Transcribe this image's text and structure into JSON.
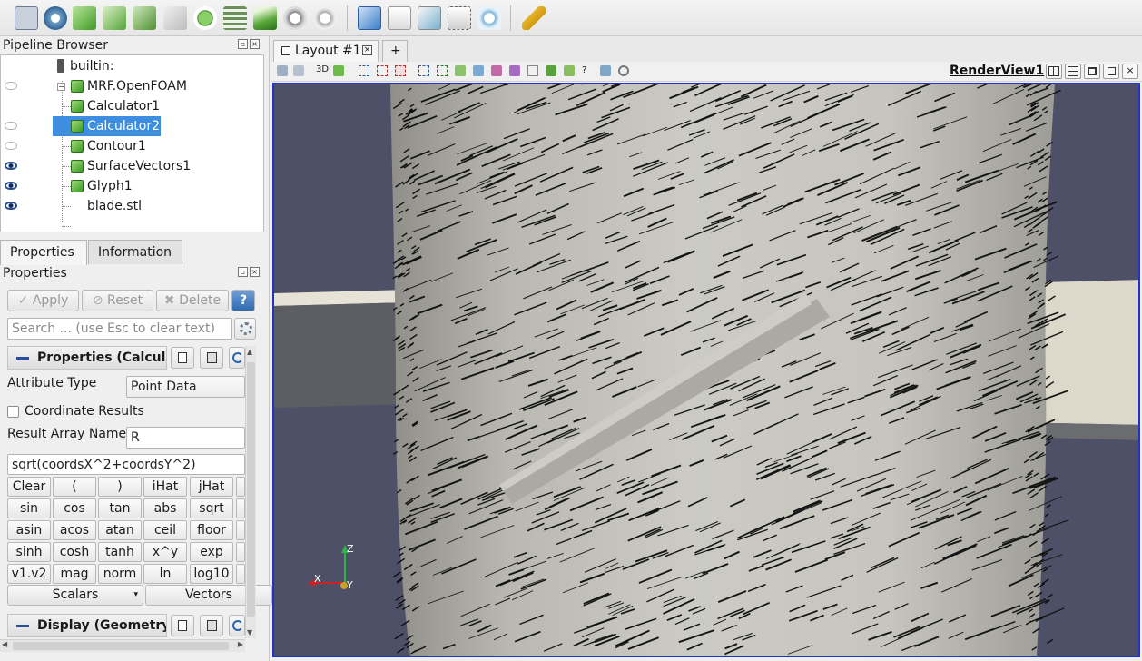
{
  "toolbar": {
    "icons": [
      "calculator-icon",
      "contour-icon",
      "clip-icon",
      "slice-icon",
      "threshold-icon",
      "extract-subset-icon",
      "glyph-icon",
      "stream-tracer-icon",
      "warp-by-vector-icon",
      "group-datasets-icon",
      "extract-level-icon",
      "select-cells-icon",
      "histogram-icon",
      "plot-over-line-icon",
      "probe-icon",
      "axes-grid-icon",
      "ruler-icon"
    ]
  },
  "pipeline_browser": {
    "title": "Pipeline Browser",
    "items": [
      {
        "label": "builtin:",
        "visible": null,
        "selected": false
      },
      {
        "label": "MRF.OpenFOAM",
        "visible": false,
        "selected": false
      },
      {
        "label": "Calculator1",
        "visible": false,
        "selected": false
      },
      {
        "label": "Calculator2",
        "visible": false,
        "selected": true
      },
      {
        "label": "Contour1",
        "visible": false,
        "selected": false
      },
      {
        "label": "SurfaceVectors1",
        "visible": true,
        "selected": false
      },
      {
        "label": "Glyph1",
        "visible": true,
        "selected": false
      },
      {
        "label": "blade.stl",
        "visible": true,
        "selected": false
      }
    ]
  },
  "tabs": {
    "properties": "Properties",
    "information": "Information"
  },
  "properties": {
    "title": "Properties",
    "apply": "Apply",
    "reset": "Reset",
    "delete": "Delete",
    "help": "?",
    "search_placeholder": "Search ... (use Esc to clear text)",
    "section_properties": "Properties (Calcula",
    "attribute_type_label": "Attribute Type",
    "attribute_type_value": "Point Data",
    "coordinate_results_label": "Coordinate Results",
    "result_array_label": "Result Array Name",
    "result_array_value": "R",
    "expression": "sqrt(coordsX^2+coordsY^2)",
    "keypad": [
      [
        "Clear",
        "(",
        ")",
        "iHat",
        "jHat"
      ],
      [
        "sin",
        "cos",
        "tan",
        "abs",
        "sqrt"
      ],
      [
        "asin",
        "acos",
        "atan",
        "ceil",
        "floor"
      ],
      [
        "sinh",
        "cosh",
        "tanh",
        "x^y",
        "exp"
      ],
      [
        "v1.v2",
        "mag",
        "norm",
        "ln",
        "log10"
      ]
    ],
    "scalars": "Scalars",
    "vectors": "Vectors",
    "section_display": "Display (Geometry"
  },
  "layout": {
    "tab_label": "Layout #1",
    "add_tab": "+",
    "render_view": "RenderView1",
    "three_d": "3D"
  },
  "axes": {
    "x": "X",
    "y": "Y",
    "z": "Z"
  },
  "colors": {
    "selection": "#3d8ee0",
    "background": "#4d5066",
    "cylinder": "#c9c8c1",
    "view_border": "#1f33c8"
  }
}
